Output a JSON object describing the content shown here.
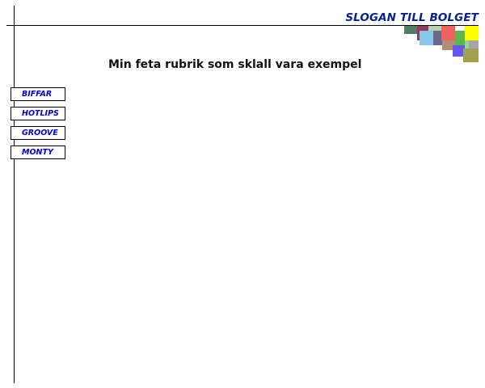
{
  "slogan": "SLOGAN TILL BOLGET",
  "headline": "Min feta rubrik som sklall vara exempel",
  "nav": {
    "items": [
      {
        "label": "BIFFAR"
      },
      {
        "label": "HOTLIPS"
      },
      {
        "label": "GROOVE"
      },
      {
        "label": "MONTY"
      }
    ]
  },
  "colors": {
    "slogan": "#0a1f8f",
    "nav_text": "#0000cc",
    "decor_squares": [
      "#557a66",
      "#8a3d5e",
      "#b8cfb4",
      "#86c6ea",
      "#6b6a8e",
      "#f26060",
      "#5ab84a",
      "#ffff00",
      "#a89272",
      "#6655ee",
      "#96d48a",
      "#a0a050",
      "#a2a6a6"
    ]
  }
}
